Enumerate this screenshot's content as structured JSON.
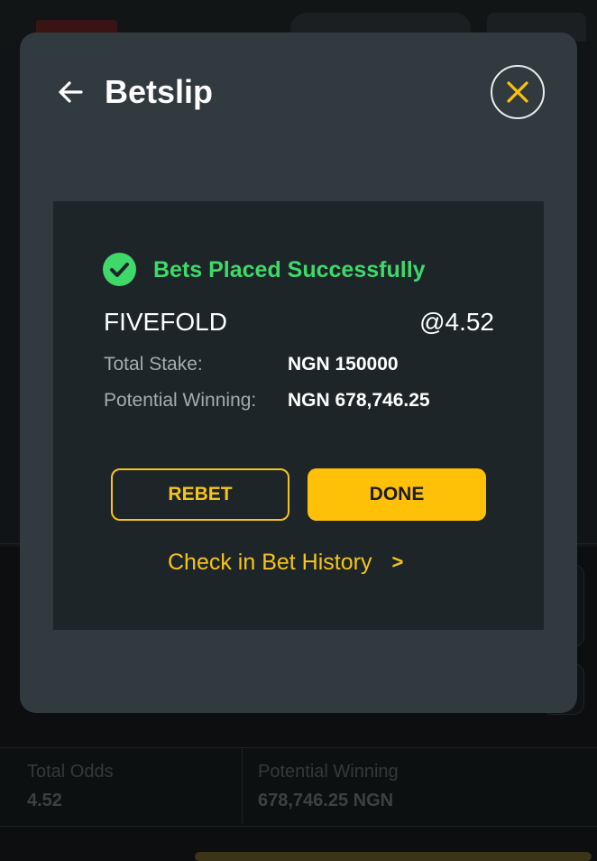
{
  "modal": {
    "title": "Betslip",
    "status": "Bets Placed Successfully",
    "bet_type": "FIVEFOLD",
    "odds": "@4.52",
    "rows": [
      {
        "label": "Total Stake:",
        "value": "NGN 150000"
      },
      {
        "label": "Potential Winning:",
        "value": "NGN 678,746.25"
      }
    ],
    "rebet_label": "REBET",
    "done_label": "DONE",
    "history_link": "Check in Bet History",
    "history_chevron": ">"
  },
  "footer": {
    "total_odds_label": "Total Odds",
    "total_odds_value": "4.52",
    "potential_winning_label": "Potential Winning",
    "potential_winning_value": "678,746.25 NGN"
  },
  "colors": {
    "accent": "#ffc107",
    "success": "#3fd96a",
    "modal_bg": "#313a3e",
    "card_bg": "#1d2528"
  },
  "icons": {
    "back": "arrow-left-icon",
    "close": "close-icon",
    "success": "check-circle-icon"
  }
}
